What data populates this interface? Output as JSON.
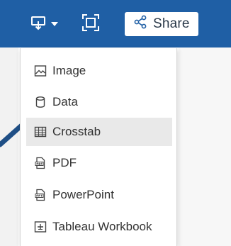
{
  "toolbar": {
    "download_icon": "download-icon",
    "fullscreen_icon": "fullscreen-icon",
    "share_icon": "share-icon",
    "share_label": "Share"
  },
  "menu": {
    "items": [
      {
        "label": "Image",
        "icon": "image-icon"
      },
      {
        "label": "Data",
        "icon": "database-icon"
      },
      {
        "label": "Crosstab",
        "icon": "table-icon"
      },
      {
        "label": "PDF",
        "icon": "pdf-file-icon"
      },
      {
        "label": "PowerPoint",
        "icon": "powerpoint-file-icon"
      },
      {
        "label": "Tableau Workbook",
        "icon": "workbook-file-icon"
      }
    ],
    "active_item": "Crosstab"
  },
  "colors": {
    "toolbar_bg": "#1f5fa5",
    "menu_bg": "#ffffff",
    "active_bg": "#e9e9e9",
    "pointer": "#1f4f86"
  }
}
